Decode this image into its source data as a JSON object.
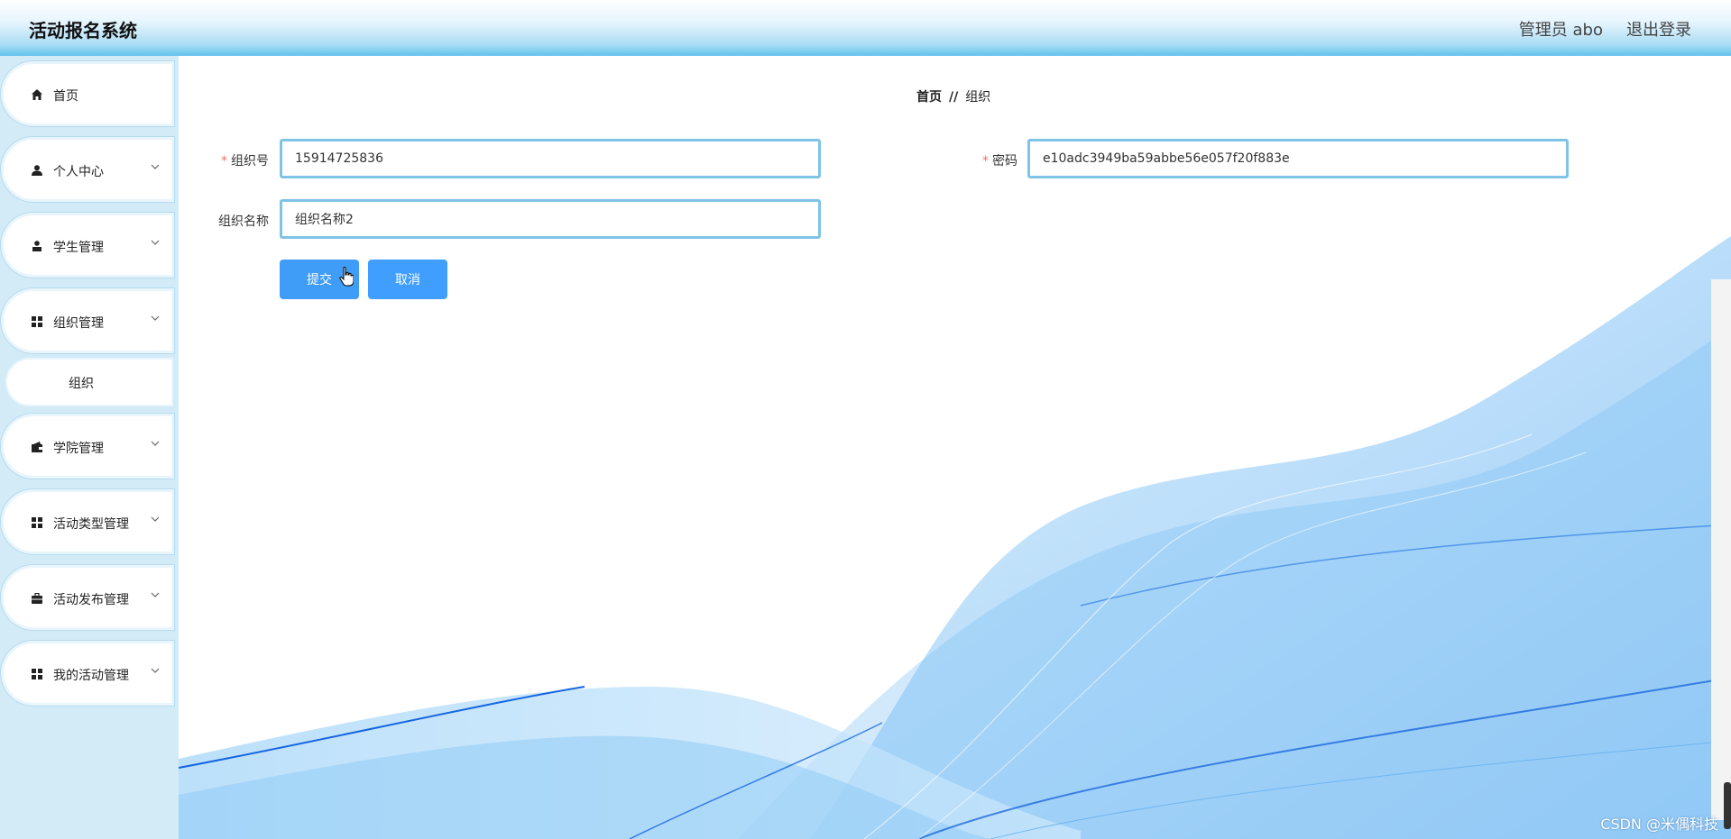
{
  "header": {
    "title": "活动报名系统",
    "user": "管理员 abo",
    "logout": "退出登录"
  },
  "sidebar": {
    "items": [
      {
        "label": "首页",
        "icon": "home-icon"
      },
      {
        "label": "个人中心",
        "icon": "user-icon"
      },
      {
        "label": "学生管理",
        "icon": "student-icon"
      },
      {
        "label": "组织管理",
        "icon": "grid-icon"
      },
      {
        "label": "学院管理",
        "icon": "wallet-icon"
      },
      {
        "label": "活动类型管理",
        "icon": "grid-icon"
      },
      {
        "label": "活动发布管理",
        "icon": "briefcase-icon"
      },
      {
        "label": "我的活动管理",
        "icon": "grid-icon"
      }
    ],
    "sub_item": "组织"
  },
  "breadcrumb": {
    "home": "首页",
    "separator": "//",
    "current": "组织"
  },
  "form": {
    "org_no_label": "组织号",
    "org_no_value": "15914725836",
    "password_label": "密码",
    "password_value": "e10adc3949ba59abbe56e057f20f883e",
    "org_name_label": "组织名称",
    "org_name_value": "组织名称2",
    "required_mark": "*"
  },
  "buttons": {
    "submit": "提交",
    "cancel": "取消"
  },
  "watermark": "CSDN @米偶科技",
  "colors": {
    "primary": "#409eff",
    "input_border": "#7fc3e6",
    "sidebar_bg": "#d3ebf7",
    "required": "#f56c6c"
  }
}
